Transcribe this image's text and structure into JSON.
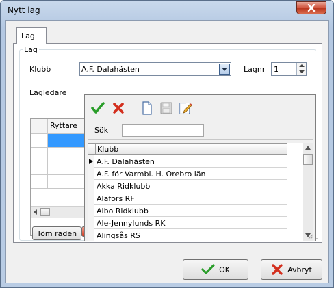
{
  "window": {
    "title": "Nytt lag"
  },
  "tabs": [
    {
      "label": "Lag"
    }
  ],
  "group": {
    "legend": "Lag"
  },
  "fields": {
    "klubb_label": "Klubb",
    "klubb_value": "A.F. Dalahästen",
    "lagnr_label": "Lagnr",
    "lagnr_value": "1",
    "lagledare_label": "Lagledare"
  },
  "left_grid": {
    "column_header": "Ryttare"
  },
  "popup": {
    "search_label": "Sök",
    "search_value": "",
    "column_header": "Klubb",
    "rows": [
      "A.F. Dalahästen",
      "A.F. för Varmbl. H. Örebro län",
      "Akka Ridklubb",
      "Alafors RF",
      "Albo Ridklubb",
      "Ale-Jennylunds RK",
      "Alingsås RS"
    ]
  },
  "actions": {
    "clear_row": "Töm raden",
    "ok": "OK",
    "cancel": "Avbryt"
  },
  "colors": {
    "accent_green": "#2a9d2a",
    "cancel_red": "#d32f1e",
    "selection_blue": "#3399ff"
  }
}
